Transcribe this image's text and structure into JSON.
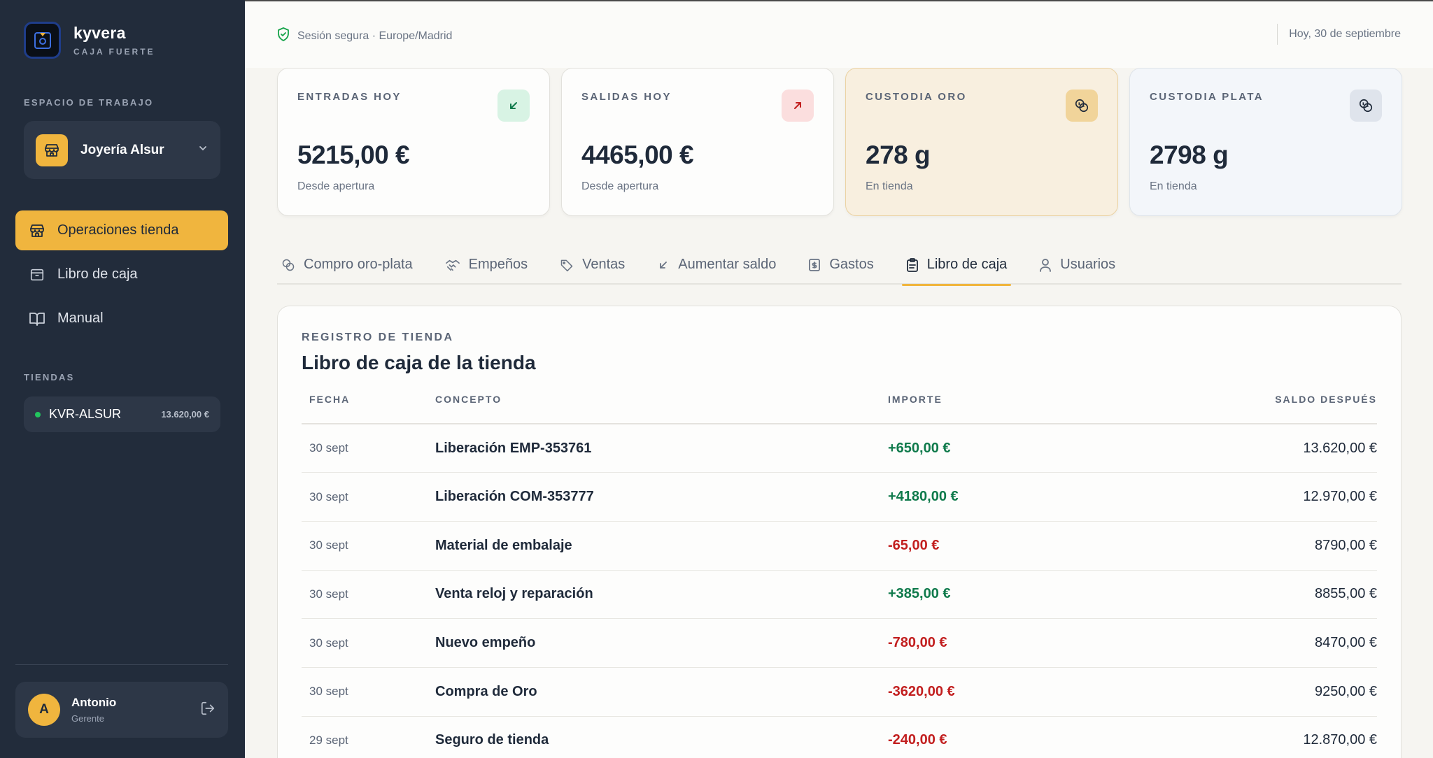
{
  "brand": {
    "name": "kyvera",
    "subtitle": "CAJA FUERTE"
  },
  "sidebar": {
    "workspace_label": "ESPACIO DE TRABAJO",
    "workspace": {
      "name": "Joyería Alsur",
      "icon": "store-icon"
    },
    "nav": [
      {
        "label": "Operaciones tienda",
        "icon": "store-icon",
        "active": true
      },
      {
        "label": "Libro de caja",
        "icon": "archive-icon",
        "active": false
      },
      {
        "label": "Manual",
        "icon": "book-icon",
        "active": false
      }
    ],
    "stores_label": "TIENDAS",
    "store": {
      "name": "KVR-ALSUR",
      "balance": "13.620,00 €",
      "status_color": "#22c55e"
    },
    "user": {
      "initial": "A",
      "name": "Antonio",
      "role": "Gerente"
    }
  },
  "header": {
    "secure_text": "Sesión segura · Europe/Madrid",
    "date_text": "Hoy, 30 de septiembre"
  },
  "stats": [
    {
      "label": "ENTRADAS HOY",
      "value": "5215,00 €",
      "sub": "Desde apertura",
      "icon": "arrow-down-left-icon"
    },
    {
      "label": "SALIDAS HOY",
      "value": "4465,00 €",
      "sub": "Desde apertura",
      "icon": "arrow-up-right-icon"
    },
    {
      "label": "CUSTODIA ORO",
      "value": "278 g",
      "sub": "En tienda",
      "icon": "coins-icon"
    },
    {
      "label": "CUSTODIA PLATA",
      "value": "2798 g",
      "sub": "En tienda",
      "icon": "coins-icon"
    }
  ],
  "tabs": [
    {
      "label": "Compro oro-plata",
      "icon": "coins-icon",
      "active": false
    },
    {
      "label": "Empeños",
      "icon": "handshake-icon",
      "active": false
    },
    {
      "label": "Ventas",
      "icon": "tag-icon",
      "active": false
    },
    {
      "label": "Aumentar saldo",
      "icon": "arrow-down-left-icon",
      "active": false
    },
    {
      "label": "Gastos",
      "icon": "receipt-icon",
      "active": false
    },
    {
      "label": "Libro de caja",
      "icon": "clipboard-icon",
      "active": true
    },
    {
      "label": "Usuarios",
      "icon": "user-icon",
      "active": false
    }
  ],
  "ledger": {
    "kicker": "REGISTRO DE TIENDA",
    "title": "Libro de caja de la tienda",
    "columns": [
      "FECHA",
      "CONCEPTO",
      "IMPORTE",
      "SALDO DESPUÉS"
    ],
    "rows": [
      {
        "date": "30 sept",
        "concept": "Liberación EMP-353761",
        "amount": "+650,00 €",
        "balance": "13.620,00 €"
      },
      {
        "date": "30 sept",
        "concept": "Liberación COM-353777",
        "amount": "+4180,00 €",
        "balance": "12.970,00 €"
      },
      {
        "date": "30 sept",
        "concept": "Material de embalaje",
        "amount": "-65,00 €",
        "balance": "8790,00 €"
      },
      {
        "date": "30 sept",
        "concept": "Venta reloj y reparación",
        "amount": "+385,00 €",
        "balance": "8855,00 €"
      },
      {
        "date": "30 sept",
        "concept": "Nuevo empeño",
        "amount": "-780,00 €",
        "balance": "8470,00 €"
      },
      {
        "date": "30 sept",
        "concept": "Compra de Oro",
        "amount": "-3620,00 €",
        "balance": "9250,00 €"
      },
      {
        "date": "29 sept",
        "concept": "Seguro de tienda",
        "amount": "-240,00 €",
        "balance": "12.870,00 €"
      }
    ]
  },
  "colors": {
    "accent": "#f0b53e",
    "sidebar": "#222c3b",
    "positive": "#0f7a4b",
    "negative": "#c21f1f"
  }
}
